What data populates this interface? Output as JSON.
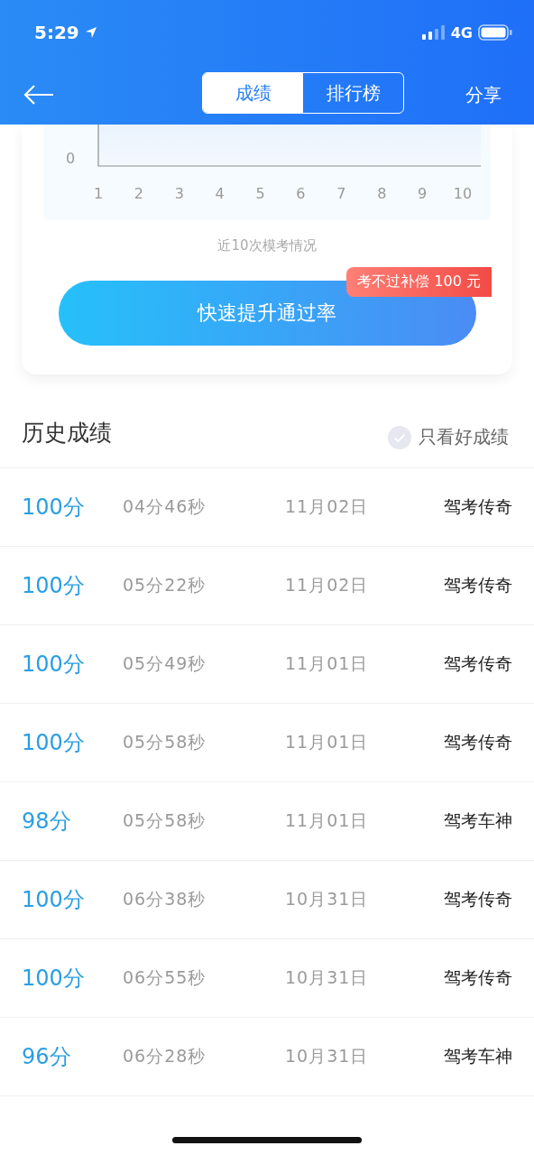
{
  "status_bar": {
    "time": "5:29",
    "network": "4G"
  },
  "nav": {
    "tabs": [
      {
        "label": "成绩",
        "selected": true
      },
      {
        "label": "排行榜",
        "selected": false
      }
    ],
    "share": "分享"
  },
  "chart": {
    "y_labels": [
      "0"
    ],
    "x_labels": [
      "1",
      "2",
      "3",
      "4",
      "5",
      "6",
      "7",
      "8",
      "9",
      "10"
    ],
    "caption": "近10次模考情况"
  },
  "promo_button": {
    "label": "快速提升通过率",
    "badge": "考不过补偿 100 元"
  },
  "history": {
    "title": "历史成绩",
    "filter": {
      "label": "只看好成绩",
      "checked": false
    },
    "rows": [
      {
        "score": "100分",
        "duration": "04分46秒",
        "date": "11月02日",
        "mode": "驾考传奇"
      },
      {
        "score": "100分",
        "duration": "05分22秒",
        "date": "11月02日",
        "mode": "驾考传奇"
      },
      {
        "score": "100分",
        "duration": "05分49秒",
        "date": "11月01日",
        "mode": "驾考传奇"
      },
      {
        "score": "100分",
        "duration": "05分58秒",
        "date": "11月01日",
        "mode": "驾考传奇"
      },
      {
        "score": "98分",
        "duration": "05分58秒",
        "date": "11月01日",
        "mode": "驾考车神"
      },
      {
        "score": "100分",
        "duration": "06分38秒",
        "date": "10月31日",
        "mode": "驾考传奇"
      },
      {
        "score": "100分",
        "duration": "06分55秒",
        "date": "10月31日",
        "mode": "驾考传奇"
      },
      {
        "score": "96分",
        "duration": "06分28秒",
        "date": "10月31日",
        "mode": "驾考车神"
      }
    ]
  }
}
